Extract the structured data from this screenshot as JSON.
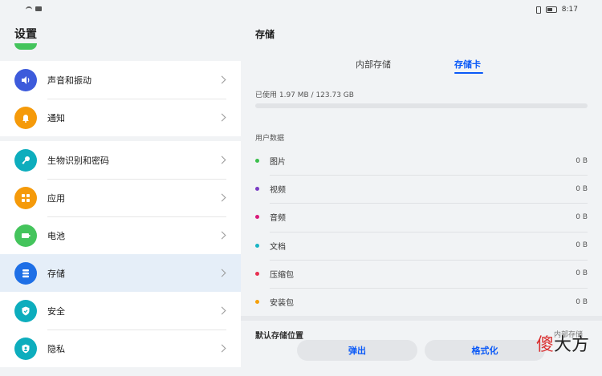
{
  "status": {
    "time": "8:17"
  },
  "left": {
    "title": "设置",
    "groups": [
      {
        "items": [
          {
            "label": "声音和振动",
            "icon": "volume-icon",
            "color": "#3d5bdb"
          },
          {
            "label": "通知",
            "icon": "bell-icon",
            "color": "#f59a0a"
          }
        ]
      },
      {
        "items": [
          {
            "label": "生物识别和密码",
            "icon": "key-icon",
            "color": "#0dadbd"
          },
          {
            "label": "应用",
            "icon": "grid-icon",
            "color": "#f59a0a"
          },
          {
            "label": "电池",
            "icon": "battery-icon",
            "color": "#44c45c"
          },
          {
            "label": "存储",
            "icon": "storage-icon",
            "color": "#1e6fe6",
            "selected": true
          },
          {
            "label": "安全",
            "icon": "shield-check-icon",
            "color": "#0dadbd"
          },
          {
            "label": "隐私",
            "icon": "privacy-icon",
            "color": "#0dadbd"
          }
        ]
      }
    ]
  },
  "right": {
    "title": "存储",
    "tabs": [
      {
        "label": "内部存储"
      },
      {
        "label": "存储卡",
        "active": true
      }
    ],
    "usage_text": "已使用 1.97 MB / 123.73 GB",
    "usage_fraction": 0,
    "section_label": "用户数据",
    "items": [
      {
        "label": "图片",
        "value": "0 B",
        "color": "#3bbf4c"
      },
      {
        "label": "视频",
        "value": "0 B",
        "color": "#7a3cc4"
      },
      {
        "label": "音频",
        "value": "0 B",
        "color": "#d9197a"
      },
      {
        "label": "文档",
        "value": "0 B",
        "color": "#19b4c4"
      },
      {
        "label": "压缩包",
        "value": "0 B",
        "color": "#e83050"
      },
      {
        "label": "安装包",
        "value": "0 B",
        "color": "#f5a00a"
      }
    ],
    "default_location_label": "默认存储位置",
    "default_location_value": "内部存储",
    "buttons": {
      "eject": "弹出",
      "format": "格式化"
    }
  },
  "watermark": {
    "part1": "傻",
    "part2": "大方"
  }
}
